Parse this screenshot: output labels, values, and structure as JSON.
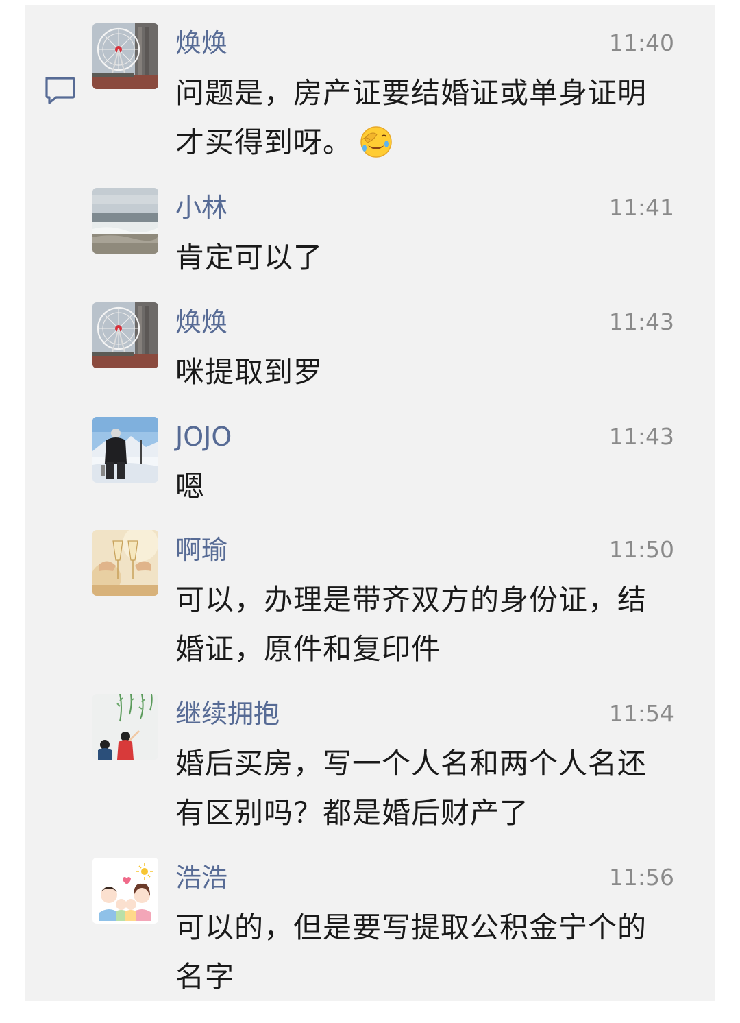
{
  "colors": {
    "panel_background": "#f2f2f2",
    "sender_name": "#576b95",
    "timestamp": "#8a8a8a",
    "message_text": "#1a1a1a"
  },
  "messages": [
    {
      "sender": "焕焕",
      "time": "11:40",
      "text": "问题是，房产证要结婚证或单身证明才买得到呀。",
      "emoji": "face-hiding-laugh-emoji",
      "avatar": "ferris-wheel-photo"
    },
    {
      "sender": "小林",
      "time": "11:41",
      "text": "肯定可以了",
      "avatar": "beach-waves-photo"
    },
    {
      "sender": "焕焕",
      "time": "11:43",
      "text": "咪提取到罗",
      "avatar": "ferris-wheel-photo"
    },
    {
      "sender": "JOJO",
      "time": "11:43",
      "text": "嗯",
      "avatar": "snow-mountain-person-photo"
    },
    {
      "sender": "啊瑜",
      "time": "11:50",
      "text": "可以，办理是带齐双方的身份证，结婚证，原件和复印件",
      "avatar": "champagne-toast-photo"
    },
    {
      "sender": "继续拥抱",
      "time": "11:54",
      "text": "婚后买房，写一个人名和两个人名还有区别吗？都是婚后财产了",
      "avatar": "children-wall-photo"
    },
    {
      "sender": "浩浩",
      "time": "11:56",
      "text": "可以的，但是要写提取公积金宁个的名字",
      "avatar": "cartoon-family-avatar"
    }
  ]
}
